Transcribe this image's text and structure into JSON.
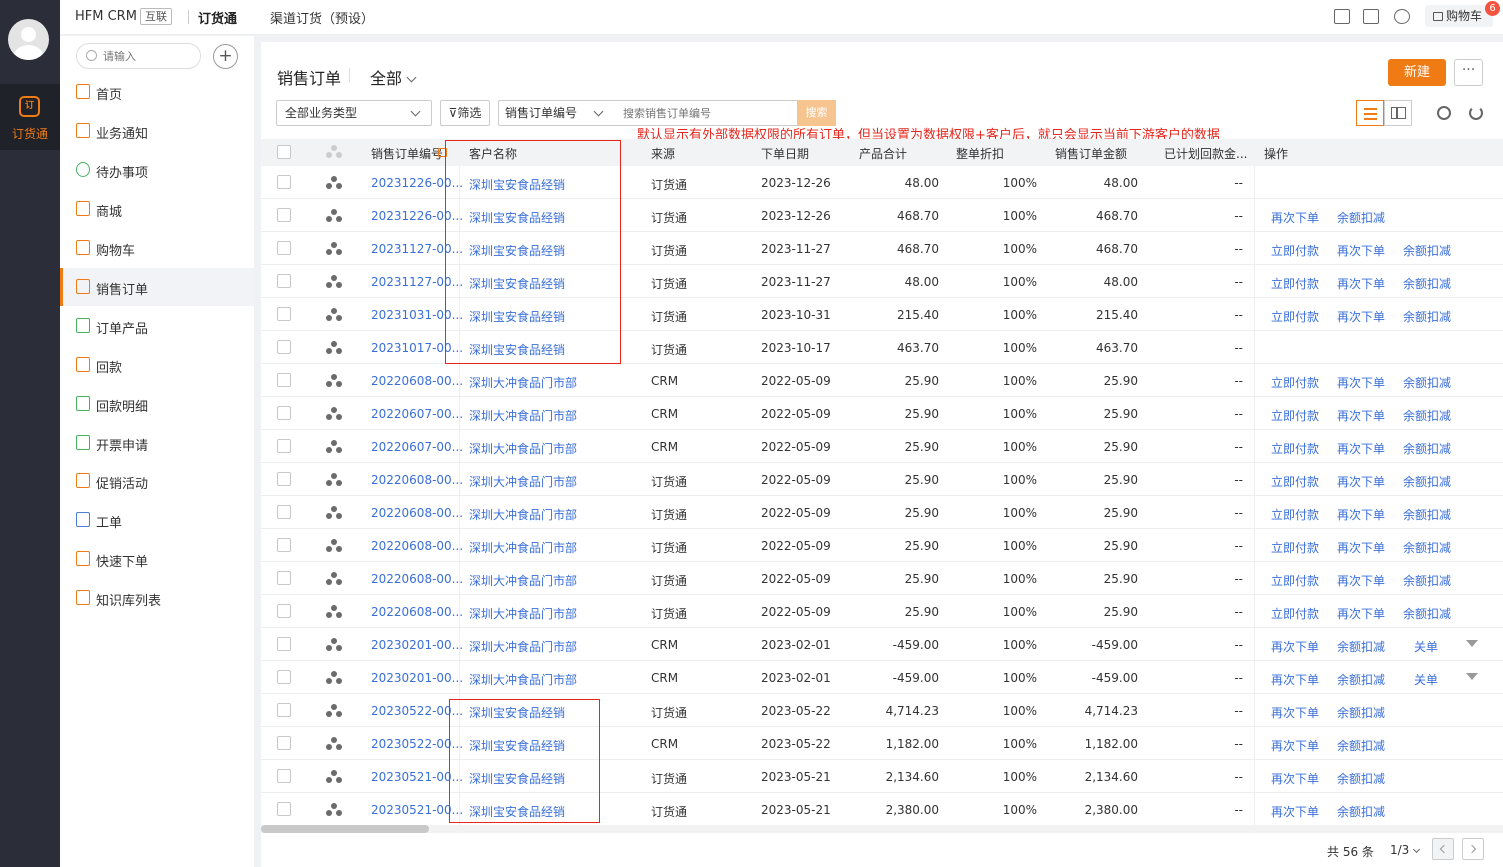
{
  "topbar": {
    "brand": "HFM CRM",
    "tag": "互联",
    "app": "订货通",
    "channel": "渠道订货（预设）",
    "cart_label": "购物车",
    "cart_count": "6"
  },
  "rail": {
    "app_icon": "订",
    "app_label": "订货通"
  },
  "sidebar": {
    "search_placeholder": "请输入",
    "items": [
      {
        "label": "首页",
        "icon": "home-icon"
      },
      {
        "label": "业务通知",
        "icon": "bell-icon"
      },
      {
        "label": "待办事项",
        "icon": "check-circle-icon"
      },
      {
        "label": "商城",
        "icon": "shopping-bag-icon"
      },
      {
        "label": "购物车",
        "icon": "cart-icon"
      },
      {
        "label": "销售订单",
        "icon": "document-icon"
      },
      {
        "label": "订单产品",
        "icon": "product-icon"
      },
      {
        "label": "回款",
        "icon": "payment-icon"
      },
      {
        "label": "回款明细",
        "icon": "payment-detail-icon"
      },
      {
        "label": "开票申请",
        "icon": "invoice-icon"
      },
      {
        "label": "促销活动",
        "icon": "flag-icon"
      },
      {
        "label": "工单",
        "icon": "ticket-icon"
      },
      {
        "label": "快速下单",
        "icon": "flag-icon"
      },
      {
        "label": "知识库列表",
        "icon": "flag-icon"
      }
    ]
  },
  "main": {
    "title": "销售订单",
    "filter_all": "全部",
    "new_button": "新建",
    "more_button": "···",
    "business_type": "全部业务类型",
    "screen_button": "筛选",
    "search_field": "销售订单编号",
    "search_placeholder": "搜索销售订单编号",
    "search_button": "搜索",
    "annotation": "默认显示有外部数据权限的所有订单，但当设置为数据权限+客户后，就只会显示当前下游客户的数据"
  },
  "table": {
    "headers": [
      "销售订单编号",
      "客户名称",
      "来源",
      "下单日期",
      "产品合计",
      "整单折扣",
      "销售订单金额",
      "已计划回款金...",
      "操作"
    ],
    "rows": [
      {
        "id": "20231226-00...",
        "customer": "深圳宝安食品经销",
        "source": "订货通",
        "date": "2023-12-26",
        "total": "48.00",
        "discount": "100%",
        "amount": "48.00",
        "planned": "--",
        "actions": []
      },
      {
        "id": "20231226-00...",
        "customer": "深圳宝安食品经销",
        "source": "订货通",
        "date": "2023-12-26",
        "total": "468.70",
        "discount": "100%",
        "amount": "468.70",
        "planned": "--",
        "actions": [
          "再次下单",
          "余额扣减"
        ]
      },
      {
        "id": "20231127-00...",
        "customer": "深圳宝安食品经销",
        "source": "订货通",
        "date": "2023-11-27",
        "total": "468.70",
        "discount": "100%",
        "amount": "468.70",
        "planned": "--",
        "actions": [
          "立即付款",
          "再次下单",
          "余额扣减"
        ]
      },
      {
        "id": "20231127-00...",
        "customer": "深圳宝安食品经销",
        "source": "订货通",
        "date": "2023-11-27",
        "total": "48.00",
        "discount": "100%",
        "amount": "48.00",
        "planned": "--",
        "actions": [
          "立即付款",
          "再次下单",
          "余额扣减"
        ]
      },
      {
        "id": "20231031-00...",
        "customer": "深圳宝安食品经销",
        "source": "订货通",
        "date": "2023-10-31",
        "total": "215.40",
        "discount": "100%",
        "amount": "215.40",
        "planned": "--",
        "actions": [
          "立即付款",
          "再次下单",
          "余额扣减"
        ]
      },
      {
        "id": "20231017-00...",
        "customer": "深圳宝安食品经销",
        "source": "订货通",
        "date": "2023-10-17",
        "total": "463.70",
        "discount": "100%",
        "amount": "463.70",
        "planned": "--",
        "actions": []
      },
      {
        "id": "20220608-00...",
        "customer": "深圳大冲食品门市部",
        "source": "CRM",
        "date": "2022-05-09",
        "total": "25.90",
        "discount": "100%",
        "amount": "25.90",
        "planned": "--",
        "actions": [
          "立即付款",
          "再次下单",
          "余额扣减"
        ]
      },
      {
        "id": "20220607-00...",
        "customer": "深圳大冲食品门市部",
        "source": "CRM",
        "date": "2022-05-09",
        "total": "25.90",
        "discount": "100%",
        "amount": "25.90",
        "planned": "--",
        "actions": [
          "立即付款",
          "再次下单",
          "余额扣减"
        ]
      },
      {
        "id": "20220607-00...",
        "customer": "深圳大冲食品门市部",
        "source": "CRM",
        "date": "2022-05-09",
        "total": "25.90",
        "discount": "100%",
        "amount": "25.90",
        "planned": "--",
        "actions": [
          "立即付款",
          "再次下单",
          "余额扣减"
        ]
      },
      {
        "id": "20220608-00...",
        "customer": "深圳大冲食品门市部",
        "source": "订货通",
        "date": "2022-05-09",
        "total": "25.90",
        "discount": "100%",
        "amount": "25.90",
        "planned": "--",
        "actions": [
          "立即付款",
          "再次下单",
          "余额扣减"
        ]
      },
      {
        "id": "20220608-00...",
        "customer": "深圳大冲食品门市部",
        "source": "订货通",
        "date": "2022-05-09",
        "total": "25.90",
        "discount": "100%",
        "amount": "25.90",
        "planned": "--",
        "actions": [
          "立即付款",
          "再次下单",
          "余额扣减"
        ]
      },
      {
        "id": "20220608-00...",
        "customer": "深圳大冲食品门市部",
        "source": "订货通",
        "date": "2022-05-09",
        "total": "25.90",
        "discount": "100%",
        "amount": "25.90",
        "planned": "--",
        "actions": [
          "立即付款",
          "再次下单",
          "余额扣减"
        ]
      },
      {
        "id": "20220608-00...",
        "customer": "深圳大冲食品门市部",
        "source": "订货通",
        "date": "2022-05-09",
        "total": "25.90",
        "discount": "100%",
        "amount": "25.90",
        "planned": "--",
        "actions": [
          "立即付款",
          "再次下单",
          "余额扣减"
        ]
      },
      {
        "id": "20220608-00...",
        "customer": "深圳大冲食品门市部",
        "source": "订货通",
        "date": "2022-05-09",
        "total": "25.90",
        "discount": "100%",
        "amount": "25.90",
        "planned": "--",
        "actions": [
          "立即付款",
          "再次下单",
          "余额扣减"
        ]
      },
      {
        "id": "20230201-00...",
        "customer": "深圳大冲食品门市部",
        "source": "CRM",
        "date": "2023-02-01",
        "total": "-459.00",
        "discount": "100%",
        "amount": "-459.00",
        "planned": "--",
        "actions": [
          "再次下单",
          "余额扣减",
          "关单"
        ],
        "dropdown": true
      },
      {
        "id": "20230201-00...",
        "customer": "深圳大冲食品门市部",
        "source": "CRM",
        "date": "2023-02-01",
        "total": "-459.00",
        "discount": "100%",
        "amount": "-459.00",
        "planned": "--",
        "actions": [
          "再次下单",
          "余额扣减",
          "关单"
        ],
        "dropdown": true
      },
      {
        "id": "20230522-00...",
        "customer": "深圳宝安食品经销",
        "source": "订货通",
        "date": "2023-05-22",
        "total": "4,714.23",
        "discount": "100%",
        "amount": "4,714.23",
        "planned": "--",
        "actions": [
          "再次下单",
          "余额扣减"
        ]
      },
      {
        "id": "20230522-00...",
        "customer": "深圳宝安食品经销",
        "source": "CRM",
        "date": "2023-05-22",
        "total": "1,182.00",
        "discount": "100%",
        "amount": "1,182.00",
        "planned": "--",
        "actions": [
          "再次下单",
          "余额扣减"
        ]
      },
      {
        "id": "20230521-00...",
        "customer": "深圳宝安食品经销",
        "source": "订货通",
        "date": "2023-05-21",
        "total": "2,134.60",
        "discount": "100%",
        "amount": "2,134.60",
        "planned": "--",
        "actions": [
          "再次下单",
          "余额扣减"
        ]
      },
      {
        "id": "20230521-00...",
        "customer": "深圳宝安食品经销",
        "source": "订货通",
        "date": "2023-05-21",
        "total": "2,380.00",
        "discount": "100%",
        "amount": "2,380.00",
        "planned": "--",
        "actions": [
          "再次下单",
          "余额扣减"
        ]
      }
    ]
  },
  "pagination": {
    "total": "共 56 条",
    "page": "1/3"
  },
  "colors": {
    "accent": "#f07a13",
    "link": "#3a6fd8",
    "annotation": "#e5271e"
  }
}
